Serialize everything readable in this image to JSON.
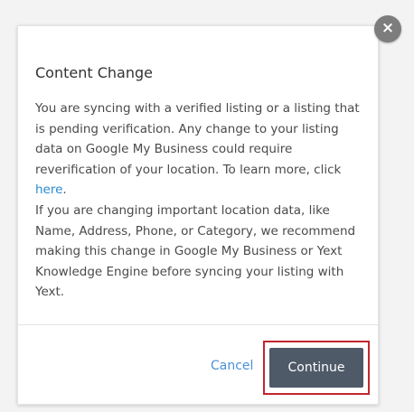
{
  "dialog": {
    "title": "Content Change",
    "body_part1": "You are syncing with a verified listing or a listing that is pending verification. Any change to your listing data on Google My Business could require reverification of your location. To learn more, click ",
    "link_text": "here",
    "body_part1_end": ".",
    "body_part2": "If you are changing important location data, like Name, Address, Phone, or Category, we recommend making this change in Google My Business or Yext Knowledge Engine before syncing your listing with Yext.",
    "close_symbol": "×",
    "cancel_label": "Cancel",
    "continue_label": "Continue"
  },
  "colors": {
    "link": "#2a8ad1",
    "primary_button": "#4f5a68",
    "highlight_border": "#c1272d"
  }
}
